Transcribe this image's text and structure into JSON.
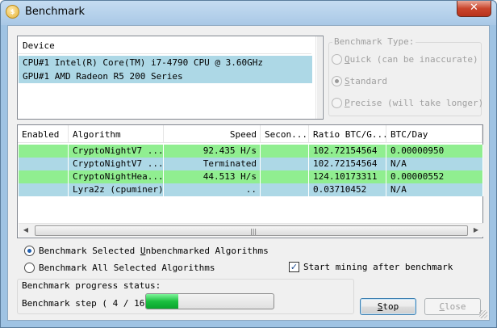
{
  "window": {
    "title": "Benchmark",
    "close_glyph": "✕",
    "app_icon": "app-logo-icon"
  },
  "devices": {
    "header": "Device",
    "items": [
      "CPU#1 Intel(R) Core(TM) i7-4790 CPU @ 3.60GHz",
      "GPU#1 AMD Radeon R5 200 Series"
    ]
  },
  "benchmark_type": {
    "legend": "Benchmark Type:",
    "options": [
      {
        "key": "Q",
        "rest": "uick (can be inaccurate)",
        "selected": false
      },
      {
        "key": "S",
        "rest": "tandard",
        "selected": true
      },
      {
        "key": "P",
        "rest": "recise (will take longer)",
        "selected": false
      }
    ],
    "enabled": false
  },
  "algorithms": {
    "columns": [
      "Enabled",
      "Algorithm",
      "Speed",
      "Secon...",
      "Ratio BTC/G...",
      "BTC/Day"
    ],
    "rows": [
      {
        "enabled": "",
        "algorithm": "CryptoNightV7 ...",
        "speed": "92.435 H/s",
        "second": "",
        "ratio": "102.72154564",
        "btc_day": "0.00000950",
        "color": "green"
      },
      {
        "enabled": "",
        "algorithm": "CryptoNightV7 ...",
        "speed": "Terminated",
        "second": "",
        "ratio": "102.72154564",
        "btc_day": "N/A",
        "color": "blue"
      },
      {
        "enabled": "",
        "algorithm": "CryptoNightHea...",
        "speed": "44.513 H/s",
        "second": "",
        "ratio": "124.10173311",
        "btc_day": "0.00000552",
        "color": "green"
      },
      {
        "enabled": "",
        "algorithm": "Lyra2z (cpuminer)",
        "speed": "..",
        "second": "",
        "ratio": "0.03710452",
        "btc_day": "N/A",
        "color": "blue"
      }
    ],
    "scroll_left": "◀",
    "scroll_right": "▶",
    "scroll_grip": "|||"
  },
  "options": {
    "unbenchmarked": {
      "pre": "Benchmark Selected ",
      "key": "U",
      "post": "nbenchmarked Algorithms",
      "selected": true
    },
    "all_selected": {
      "label": "Benchmark All Selected Algorithms",
      "selected": false
    },
    "start_mining": {
      "label": "Start mining after benchmark",
      "checked": true,
      "check_glyph": "✓"
    }
  },
  "status": {
    "caption": "Benchmark progress status:",
    "step_text": "Benchmark step ( 4 / 16 )",
    "progress_fraction": 0.25
  },
  "buttons": {
    "stop": {
      "key": "S",
      "rest": "top"
    },
    "close": {
      "key": "C",
      "rest": "lose",
      "enabled": false
    }
  },
  "colors": {
    "row_green": "#90ee90",
    "row_blue": "#add8e6",
    "progress": "#1bbf3f"
  }
}
